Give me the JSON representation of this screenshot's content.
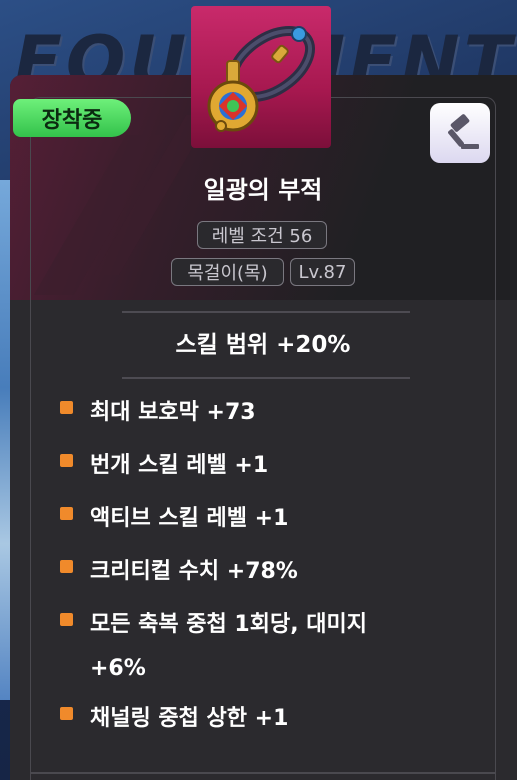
{
  "background_title": "EQUIPMENT",
  "item": {
    "status_badge": "장착중",
    "name": "일광의 부적",
    "level_requirement": "레벨 조건 56",
    "type": "목걸이(목)",
    "item_level": "Lv.87",
    "main_stat": "스킬 범위 +20%",
    "icon": "necklace-icon",
    "auction_icon": "gavel-icon"
  },
  "stats": [
    {
      "text": "최대 보호막 +73"
    },
    {
      "text": "번개 스킬 레벨 +1"
    },
    {
      "text": "액티브 스킬 레벨 +1"
    },
    {
      "text": "크리티컬 수치 +78%"
    },
    {
      "text": "모든 축복 중첩 1회당, 대미지",
      "text2": "+6%"
    },
    {
      "text": "채널링 중첩 상한 +1"
    }
  ],
  "colors": {
    "badge": "#33c24b",
    "item_box": "#c92a6b",
    "bullet": "#f08a2b",
    "panel": "#2b2a2e"
  }
}
